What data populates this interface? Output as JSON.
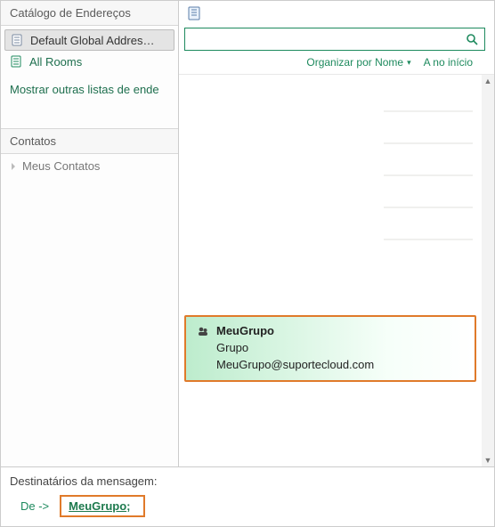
{
  "sidebar": {
    "catalog_header": "Catálogo de Endereços",
    "items": [
      {
        "label": "Default Global Addres…",
        "icon": "book"
      },
      {
        "label": "All Rooms",
        "icon": "book-green"
      }
    ],
    "more_lists_link": "Mostrar outras listas de ende",
    "contacts_header": "Contatos",
    "contacts_sub": "Meus Contatos"
  },
  "toolbar": {
    "organize_label": "Organizar por Nome",
    "to_top_label": "A no início",
    "search_placeholder": ""
  },
  "result": {
    "name": "MeuGrupo",
    "type": "Grupo",
    "email": "MeuGrupo@suportecloud.com"
  },
  "footer": {
    "recipients_label": "Destinatários da mensagem:",
    "from_label": "De ->",
    "recipient_name": "MeuGrupo",
    "recipient_sep": ";"
  }
}
